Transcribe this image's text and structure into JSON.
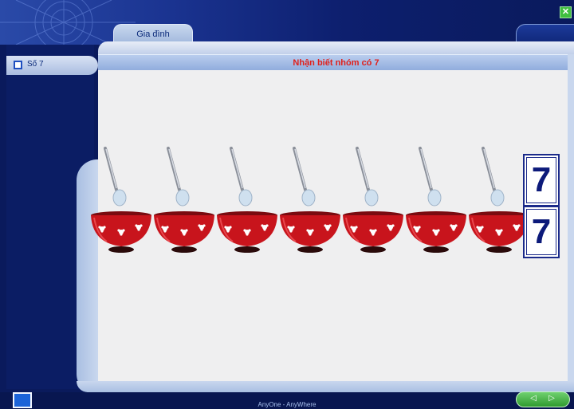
{
  "window": {
    "close_label": "✕"
  },
  "tabs": [
    {
      "label": "Gia đình"
    }
  ],
  "sidebar": {
    "items": [
      {
        "label": "Số 7"
      }
    ]
  },
  "main": {
    "title": "Nhận biết nhóm có 7",
    "spoon_count": 7,
    "bowl_count": 7,
    "number_boxes": [
      "7",
      "7"
    ]
  },
  "footer": {
    "text": "AnyOne - AnyWhere",
    "nav_prev": "◁",
    "nav_next": "▷"
  },
  "colors": {
    "title_text": "#e0201b",
    "bowl": "#c8141c",
    "background": "#0a1a5c"
  }
}
